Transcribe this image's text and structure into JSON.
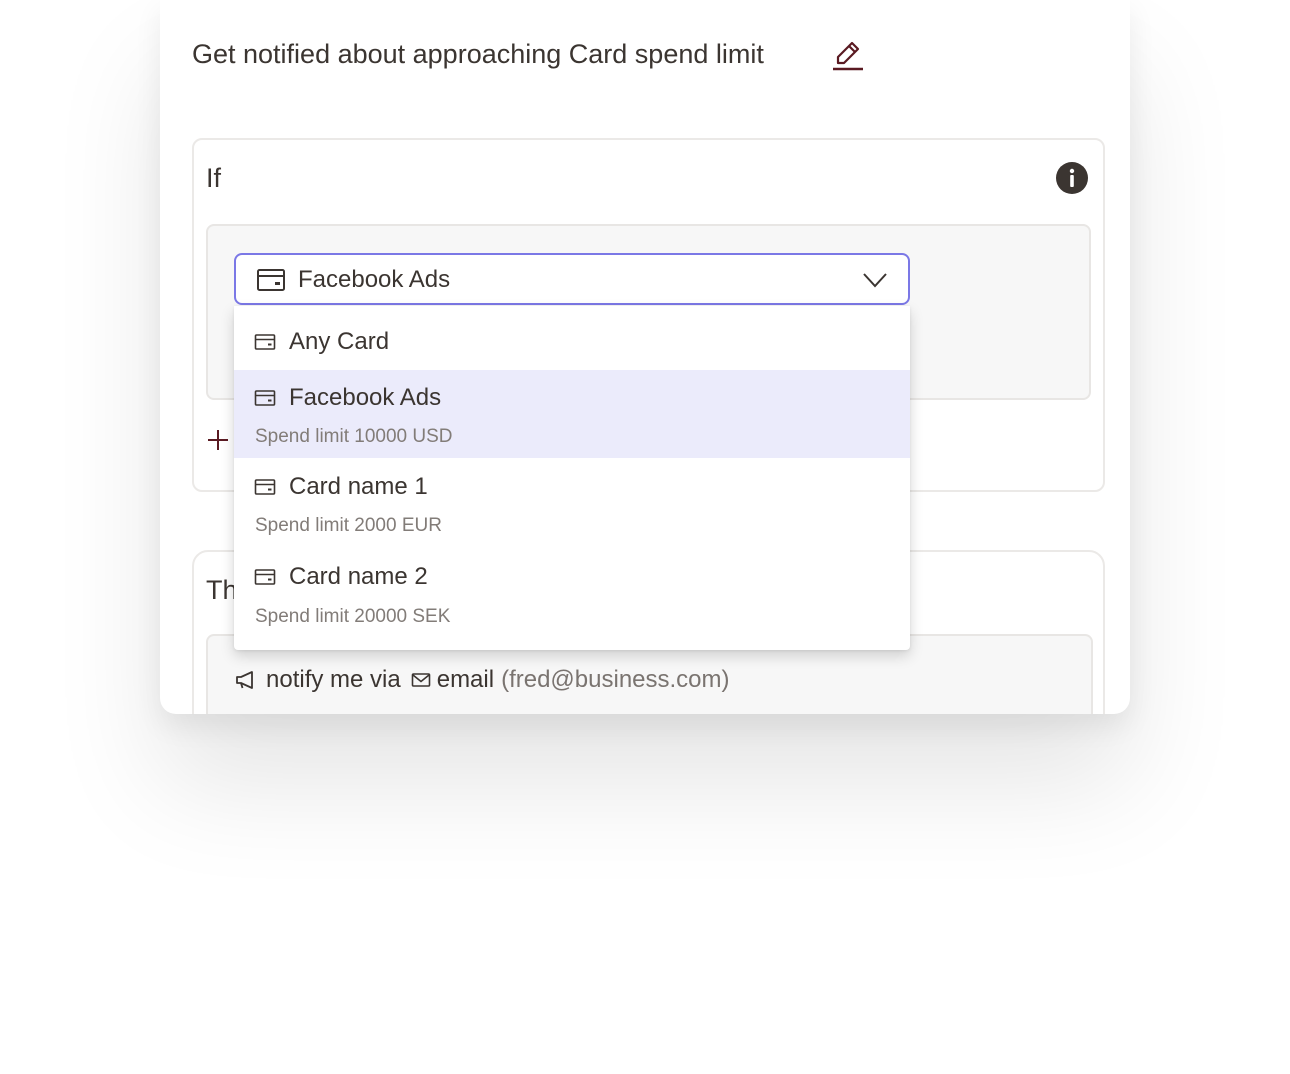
{
  "header": {
    "title": "Get notified about approaching Card spend limit",
    "edit_icon": "pencil-icon"
  },
  "if_section": {
    "label": "If",
    "info_icon": "info-icon",
    "add_icon": "plus-icon"
  },
  "card_select": {
    "selected_value": "Facebook Ads",
    "icon": "credit-card-icon",
    "chevron_icon": "chevron-down-icon",
    "border_color": "#7b78e6"
  },
  "dropdown": {
    "options": [
      {
        "name": "Any Card",
        "subtitle": ""
      },
      {
        "name": "Facebook Ads",
        "subtitle": "Spend limit 10000 USD"
      },
      {
        "name": "Card name 1",
        "subtitle": "Spend limit 2000 EUR"
      },
      {
        "name": "Card name 2",
        "subtitle": "Spend limit 20000 SEK"
      }
    ],
    "highlight_color": "#ebebfb"
  },
  "then_section": {
    "label": "Th",
    "notify_prefix": "notify me via",
    "channel": "email",
    "address": "(fred@business.com)",
    "megaphone_icon": "megaphone-icon",
    "mail_icon": "mail-icon"
  },
  "colors": {
    "text": "#3b3531",
    "muted_text": "#827c78",
    "accent_dark": "#5a1a22",
    "panel_bg": "#f7f7f7"
  }
}
